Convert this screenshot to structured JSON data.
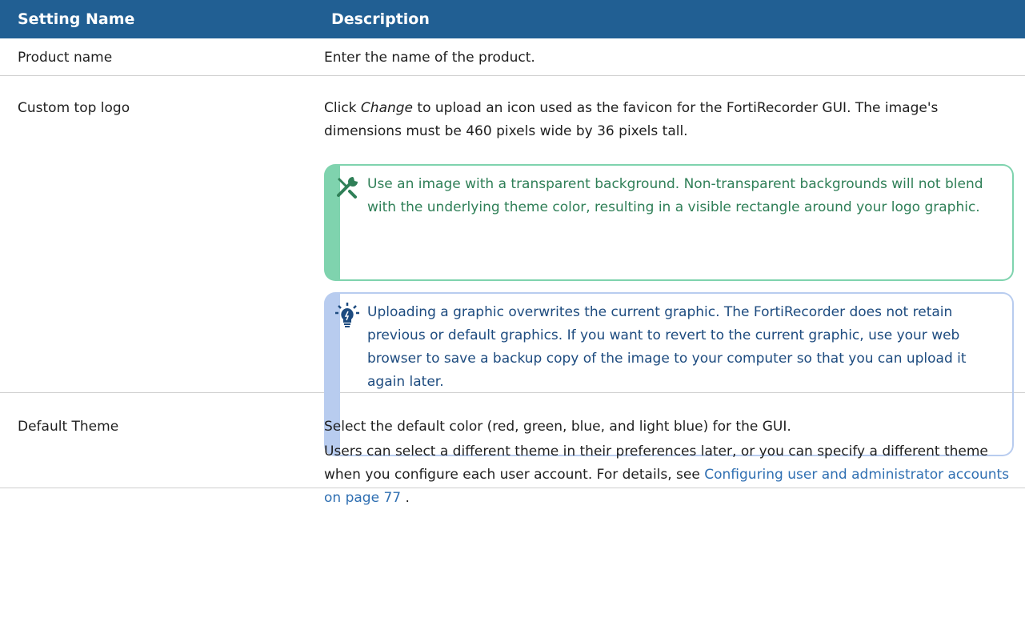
{
  "header": {
    "setting_name": "Setting Name",
    "description": "Description"
  },
  "rows": {
    "product": {
      "name": "Product name",
      "description": "Enter the name of the product."
    },
    "logo": {
      "name": "Custom top logo",
      "desc_prefix": "Click ",
      "desc_em": "Change",
      "desc_suffix": " to upload an icon used as the favicon for the FortiRecorder GUI. The image's dimensions must be 460 pixels wide by 36 pixels tall.",
      "tip_text": "Use an image with a transparent background. Non-transparent backgrounds will not blend with the underlying theme color, resulting in a visible rectangle around your logo graphic.",
      "note_text": "Uploading a graphic overwrites the current graphic. The FortiRecorder does not retain previous or default graphics. If you want to revert to the current graphic, use your web browser to save a backup copy of the image to your computer so that you can upload it again later."
    },
    "theme": {
      "name": "Default Theme",
      "desc_line1": "Select the default color (red, green, blue, and light blue) for the GUI.",
      "desc_line2_prefix": "Users can select a different theme in their preferences later, or you can specify a different theme when you configure each user account. For details, see ",
      "link_text": "Configuring user and administrator accounts on page 77",
      "desc_line2_suffix": " ."
    }
  },
  "icons": {
    "tip": "wrench-screwdriver-icon",
    "note": "lightbulb-icon"
  },
  "colors": {
    "header_bg": "#215f93",
    "tip_border": "#7fd3ae",
    "tip_text": "#2f7f57",
    "note_border": "#b8ccef",
    "note_text": "#1d4b7f",
    "link": "#2f6fb2"
  }
}
